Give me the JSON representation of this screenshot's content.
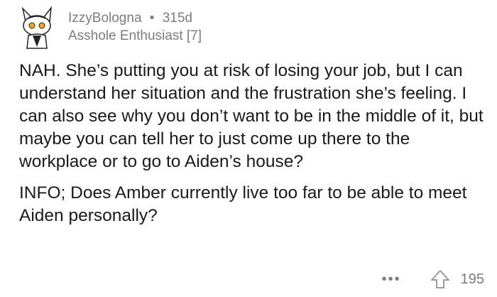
{
  "comment": {
    "username": "IzzyBologna",
    "separator": "•",
    "age": "315d",
    "flair": "Asshole Enthusiast [7]",
    "paragraphs": [
      "NAH. She’s putting you at risk of losing your job, but I can understand her situation and the frustration she’s feeling. I can also see why you don’t want to be in the middle of it, but maybe you can tell her to just come up there to the workplace or to go to Aiden’s house?",
      "INFO; Does Amber currently live too far to be able to meet Aiden personally?"
    ],
    "more_label": "•••",
    "score": "195"
  },
  "icons": {
    "avatar": "snoo-avatar-bunny-ears",
    "more": "more-options-icon",
    "upvote": "upvote-arrow-icon"
  }
}
